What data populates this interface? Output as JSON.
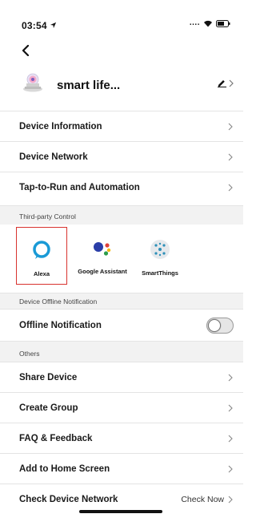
{
  "status_bar": {
    "time": "03:54",
    "signal": "...."
  },
  "device": {
    "name": "smart life..."
  },
  "menu_top": [
    {
      "label": "Device Information"
    },
    {
      "label": "Device Network"
    },
    {
      "label": "Tap-to-Run and Automation"
    }
  ],
  "sections": {
    "third_party": "Third-party Control",
    "offline": "Device Offline Notification",
    "others": "Others"
  },
  "third_party": [
    {
      "label": "Alexa",
      "selected": true,
      "icon": "alexa-icon"
    },
    {
      "label": "Google Assistant",
      "selected": false,
      "icon": "google-assistant-icon"
    },
    {
      "label": "SmartThings",
      "selected": false,
      "icon": "smartthings-icon"
    }
  ],
  "offline_notification": {
    "label": "Offline Notification",
    "enabled": false
  },
  "menu_others": [
    {
      "label": "Share Device"
    },
    {
      "label": "Create Group"
    },
    {
      "label": "FAQ & Feedback"
    },
    {
      "label": "Add to Home Screen"
    },
    {
      "label": "Check Device Network",
      "value": "Check Now"
    }
  ],
  "colors": {
    "accent_selected": "#d8332f",
    "alexa": "#1a9ad6",
    "section_bg": "#f2f2f2"
  }
}
